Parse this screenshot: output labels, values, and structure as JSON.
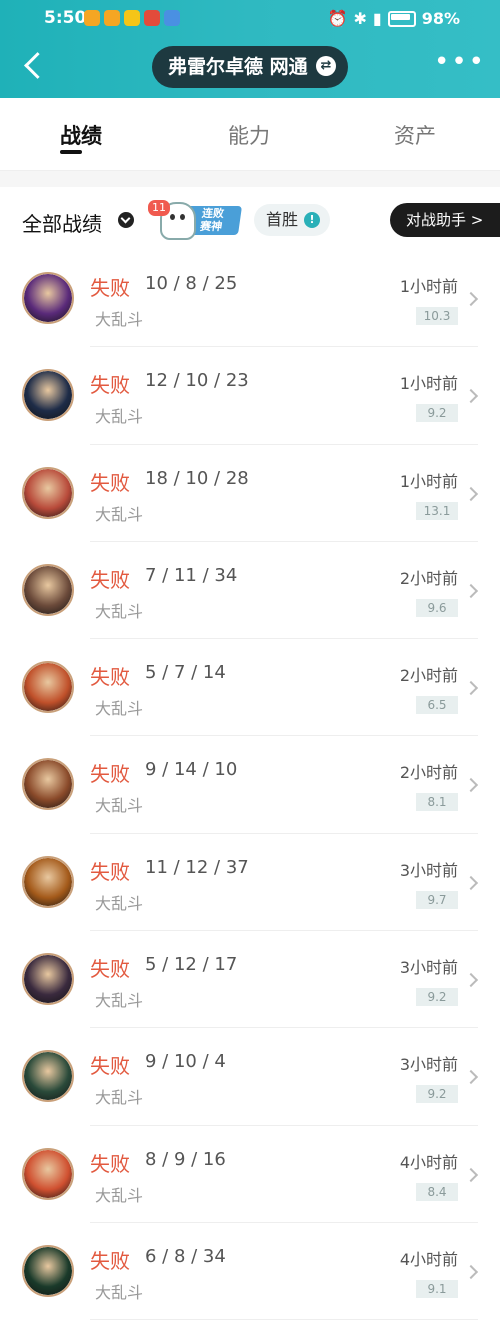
{
  "status_bar": {
    "time": "5:50",
    "battery": "98%",
    "app_icon_colors": [
      "#f5a623",
      "#f5a623",
      "#f5c518",
      "#e24b3b",
      "#4a90e2"
    ]
  },
  "header": {
    "account_name": "弗雷尔卓德 网通",
    "more_label": "•••"
  },
  "tabs": [
    {
      "label": "战绩",
      "active": true
    },
    {
      "label": "能力",
      "active": false
    },
    {
      "label": "资产",
      "active": false
    }
  ],
  "filter": {
    "title": "全部战绩",
    "streak_count": "11",
    "streak_label_line1": "连败",
    "streak_label_line2": "赛神",
    "first_win_label": "首胜",
    "assistant_label": "对战助手 >"
  },
  "colors": {
    "accent_teal": "#2fb9c1",
    "loss_red": "#e2593f"
  },
  "matches": [
    {
      "result": "失败",
      "kda": "10 / 8 / 25",
      "mode": "大乱斗",
      "time": "1小时前",
      "score": "10.3",
      "avatar_color": "#5a2a7a"
    },
    {
      "result": "失败",
      "kda": "12 / 10 / 23",
      "mode": "大乱斗",
      "time": "1小时前",
      "score": "9.2",
      "avatar_color": "#1e2c48"
    },
    {
      "result": "失败",
      "kda": "18 / 10 / 28",
      "mode": "大乱斗",
      "time": "1小时前",
      "score": "13.1",
      "avatar_color": "#b84a3a"
    },
    {
      "result": "失败",
      "kda": "7 / 11 / 34",
      "mode": "大乱斗",
      "time": "2小时前",
      "score": "9.6",
      "avatar_color": "#6b4a3a"
    },
    {
      "result": "失败",
      "kda": "5 / 7 / 14",
      "mode": "大乱斗",
      "time": "2小时前",
      "score": "6.5",
      "avatar_color": "#c0502a"
    },
    {
      "result": "失败",
      "kda": "9 / 14 / 10",
      "mode": "大乱斗",
      "time": "2小时前",
      "score": "8.1",
      "avatar_color": "#8a4a2a"
    },
    {
      "result": "失败",
      "kda": "11 / 12 / 37",
      "mode": "大乱斗",
      "time": "3小时前",
      "score": "9.7",
      "avatar_color": "#a45a1a"
    },
    {
      "result": "失败",
      "kda": "5 / 12 / 17",
      "mode": "大乱斗",
      "time": "3小时前",
      "score": "9.2",
      "avatar_color": "#3a2a3e"
    },
    {
      "result": "失败",
      "kda": "9 / 10 / 4",
      "mode": "大乱斗",
      "time": "3小时前",
      "score": "9.2",
      "avatar_color": "#2a4a3a"
    },
    {
      "result": "失败",
      "kda": "8 / 9 / 16",
      "mode": "大乱斗",
      "time": "4小时前",
      "score": "8.4",
      "avatar_color": "#d05030"
    },
    {
      "result": "失败",
      "kda": "6 / 8 / 34",
      "mode": "大乱斗",
      "time": "4小时前",
      "score": "9.1",
      "avatar_color": "#1a3a2a"
    }
  ]
}
